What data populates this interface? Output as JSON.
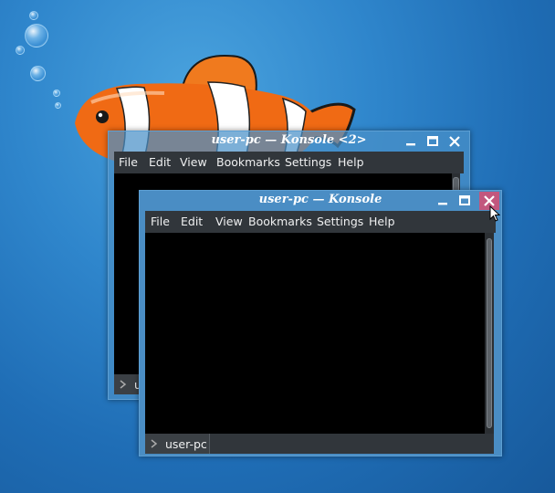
{
  "desktop": {
    "wallpaper": "clownfish-wallpaper",
    "accent": "#2f86cc"
  },
  "back_window": {
    "title": "user-pc — Konsole <2>",
    "menu": [
      "File",
      "Edit",
      "View",
      "Bookmarks",
      "Settings",
      "Help"
    ],
    "tab_label": "u",
    "icons": [
      "minimize-icon",
      "maximize-icon",
      "close-icon"
    ]
  },
  "front_window": {
    "title": "user-pc — Konsole",
    "menu": [
      "File",
      "Edit",
      "View",
      "Bookmarks",
      "Settings",
      "Help"
    ],
    "tab_label": "user-pc",
    "close_hover_color": "#c2577e",
    "icons": [
      "minimize-icon",
      "maximize-icon",
      "close-icon"
    ]
  }
}
